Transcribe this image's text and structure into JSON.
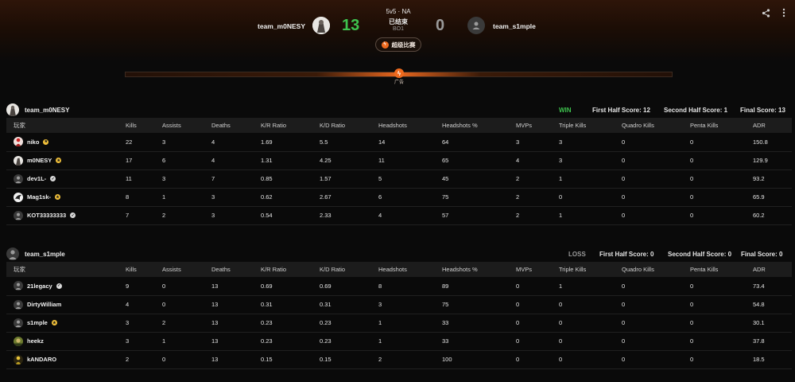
{
  "match": {
    "format": "5v5 · NA",
    "status": "已结束",
    "series": "BO1",
    "super_label": "超级比赛",
    "ad_label": "广告"
  },
  "team1": {
    "name": "team_m0NESY",
    "score": "13"
  },
  "team2": {
    "name": "team_s1mple",
    "score": "0"
  },
  "colors": {
    "win": "#3ec24e",
    "loss": "#9a9a9a",
    "accent": "#ee6a1e",
    "badge_gold": "#f2c13a",
    "badge_silver": "#d9d9d9"
  },
  "columns": [
    "玩家",
    "Kills",
    "Assists",
    "Deaths",
    "K/R Ratio",
    "K/D Ratio",
    "Headshots",
    "Headshots %",
    "MVPs",
    "Triple Kills",
    "Quadro Kills",
    "Penta Kills",
    "ADR"
  ],
  "sections": [
    {
      "team_name": "team_m0NESY",
      "result": "WIN",
      "first_half": "First Half Score: 12",
      "second_half": "Second Half Score: 1",
      "final": "Final Score: 13",
      "players": [
        {
          "name": "niko",
          "badge": "gold",
          "avatar": "red-figure",
          "stats": [
            "22",
            "3",
            "4",
            "1.69",
            "5.5",
            "14",
            "64",
            "3",
            "3",
            "0",
            "0",
            "150.8"
          ]
        },
        {
          "name": "m0NESY",
          "badge": "gold",
          "avatar": "sketch",
          "stats": [
            "17",
            "6",
            "4",
            "1.31",
            "4.25",
            "11",
            "65",
            "4",
            "3",
            "0",
            "0",
            "129.9"
          ]
        },
        {
          "name": "dev1L-",
          "badge": "silver",
          "avatar": "default",
          "stats": [
            "11",
            "3",
            "7",
            "0.85",
            "1.57",
            "5",
            "45",
            "2",
            "1",
            "0",
            "0",
            "93.2"
          ]
        },
        {
          "name": "Mag1sk-",
          "badge": "gold",
          "avatar": "bird",
          "stats": [
            "8",
            "1",
            "3",
            "0.62",
            "2.67",
            "6",
            "75",
            "2",
            "0",
            "0",
            "0",
            "65.9"
          ]
        },
        {
          "name": "KOT33333333",
          "badge": "silver",
          "avatar": "default",
          "stats": [
            "7",
            "2",
            "3",
            "0.54",
            "2.33",
            "4",
            "57",
            "2",
            "1",
            "0",
            "0",
            "60.2"
          ]
        }
      ]
    },
    {
      "team_name": "team_s1mple",
      "result": "LOSS",
      "first_half": "First Half Score: 0",
      "second_half": "Second Half Score: 0",
      "final": "Final Score: 0",
      "players": [
        {
          "name": "21legacy",
          "badge": "silver",
          "avatar": "default",
          "stats": [
            "9",
            "0",
            "13",
            "0.69",
            "0.69",
            "8",
            "89",
            "0",
            "1",
            "0",
            "0",
            "73.4"
          ]
        },
        {
          "name": "DirtyWilliam",
          "badge": "",
          "avatar": "default",
          "stats": [
            "4",
            "0",
            "13",
            "0.31",
            "0.31",
            "3",
            "75",
            "0",
            "0",
            "0",
            "0",
            "54.8"
          ]
        },
        {
          "name": "s1mple",
          "badge": "gold",
          "avatar": "default",
          "stats": [
            "3",
            "2",
            "13",
            "0.23",
            "0.23",
            "1",
            "33",
            "0",
            "0",
            "0",
            "0",
            "30.1"
          ]
        },
        {
          "name": "heekz",
          "badge": "",
          "avatar": "photo",
          "stats": [
            "3",
            "1",
            "13",
            "0.23",
            "0.23",
            "1",
            "33",
            "0",
            "0",
            "0",
            "0",
            "37.8"
          ]
        },
        {
          "name": "kANDARO",
          "badge": "",
          "avatar": "yellow-figure",
          "stats": [
            "2",
            "0",
            "13",
            "0.15",
            "0.15",
            "2",
            "100",
            "0",
            "0",
            "0",
            "0",
            "18.5"
          ]
        }
      ]
    }
  ]
}
